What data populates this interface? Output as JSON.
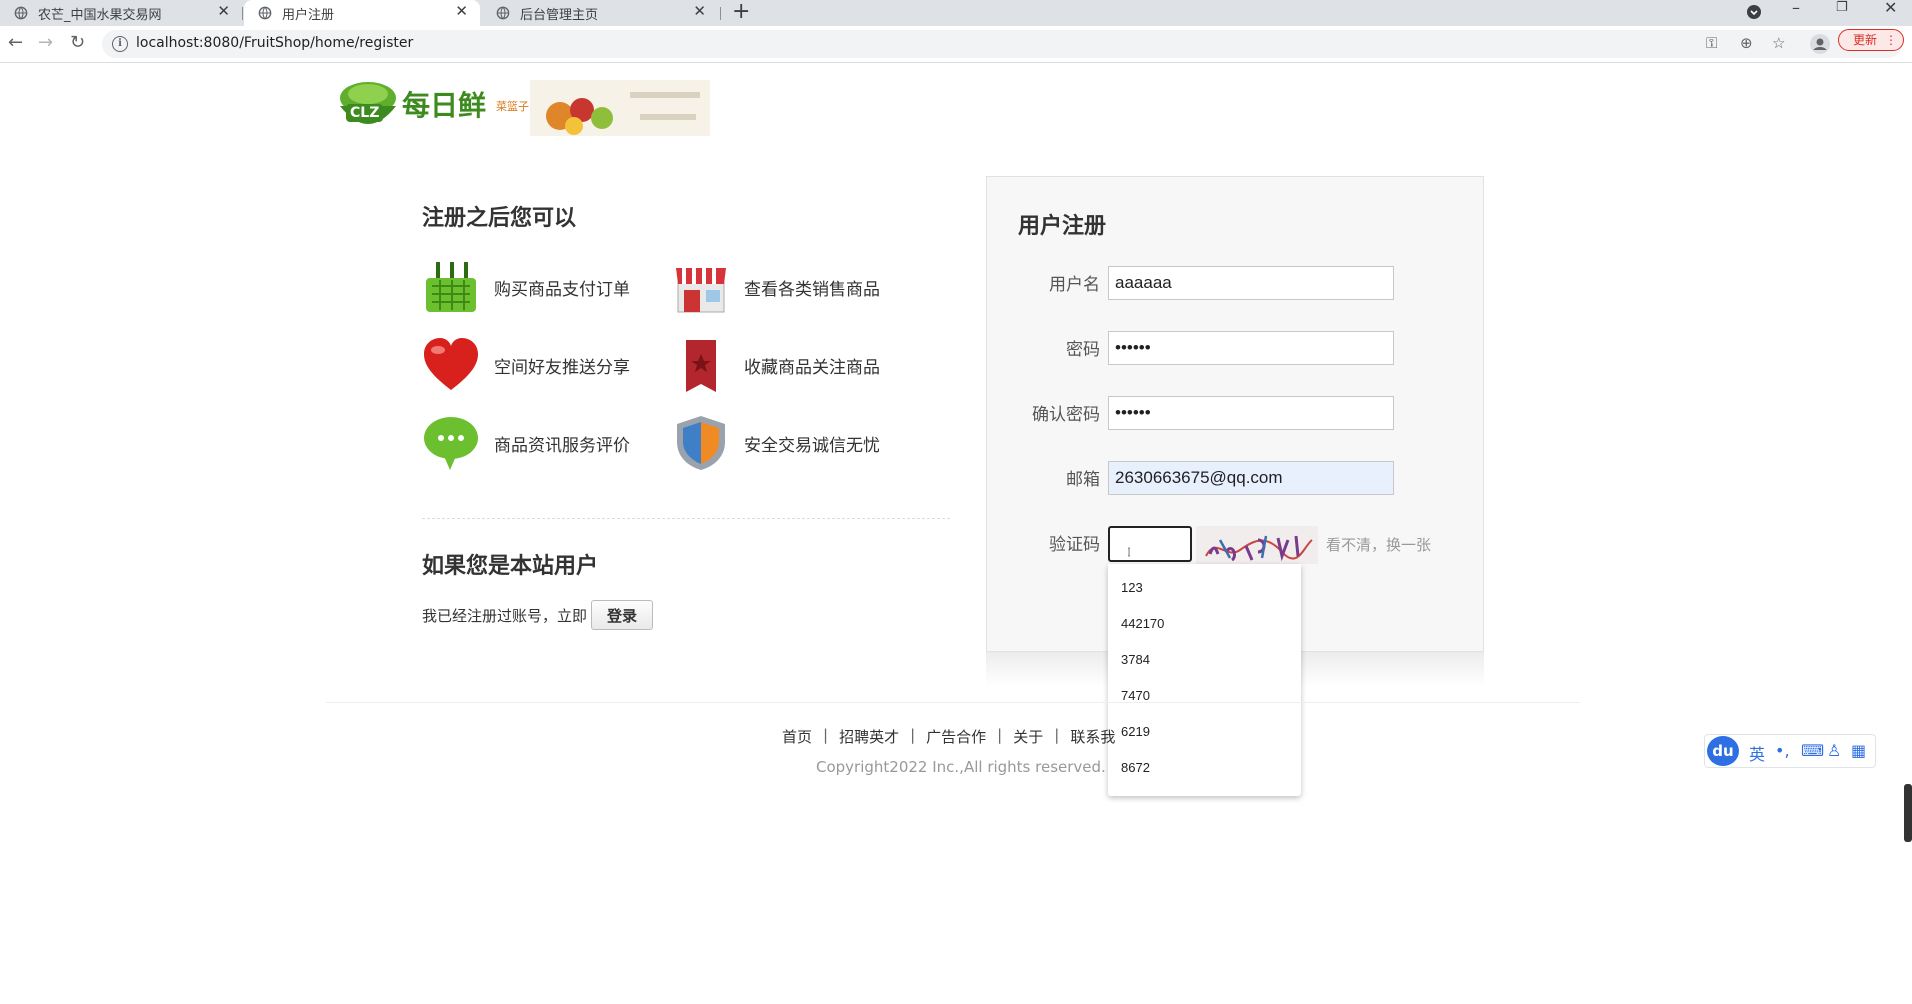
{
  "browser": {
    "tabs": [
      {
        "title": "农芒_中国水果交易网",
        "active": false
      },
      {
        "title": "用户注册",
        "active": true
      },
      {
        "title": "后台管理主页",
        "active": false
      }
    ],
    "url": "localhost:8080/FruitShop/home/register",
    "update_label": "更新"
  },
  "logo": {
    "name": "每日鲜",
    "sub": "菜篮子",
    "badge": "CLZ"
  },
  "benefits": {
    "title": "注册之后您可以",
    "items": [
      {
        "label": "购买商品支付订单",
        "icon": "basket-icon"
      },
      {
        "label": "查看各类销售商品",
        "icon": "store-icon"
      },
      {
        "label": "空间好友推送分享",
        "icon": "heart-icon"
      },
      {
        "label": "收藏商品关注商品",
        "icon": "bookmark-icon"
      },
      {
        "label": "商品资讯服务评价",
        "icon": "chat-bubble-icon"
      },
      {
        "label": "安全交易诚信无忧",
        "icon": "shield-icon"
      }
    ]
  },
  "existing_user": {
    "title": "如果您是本站用户",
    "prompt": "我已经注册过账号，立即",
    "login_label": "登录"
  },
  "register": {
    "title": "用户注册",
    "username_label": "用户名",
    "username_value": "aaaaaa",
    "password_label": "密码",
    "password_value": "••••••",
    "confirm_label": "确认密码",
    "confirm_value": "••••••",
    "email_label": "邮箱",
    "email_value": "2630663675@qq.com",
    "captcha_label": "验证码",
    "captcha_refresh": "看不清，换一张"
  },
  "autocomplete": [
    "123",
    "442170",
    "3784",
    "7470",
    "6219",
    "8672"
  ],
  "footer": {
    "links": [
      "首页",
      "招聘英才",
      "广告合作",
      "关于",
      "联系我"
    ],
    "copyright": "Copyright2022 Inc.,All rights reserved."
  },
  "ime": {
    "logo": "du",
    "lang": "英"
  },
  "colors": {
    "brand_green": "#3d8b1e",
    "autofill_blue": "#e8f0fe",
    "ime_blue": "#2f6fe4",
    "update_red": "#d93025"
  }
}
